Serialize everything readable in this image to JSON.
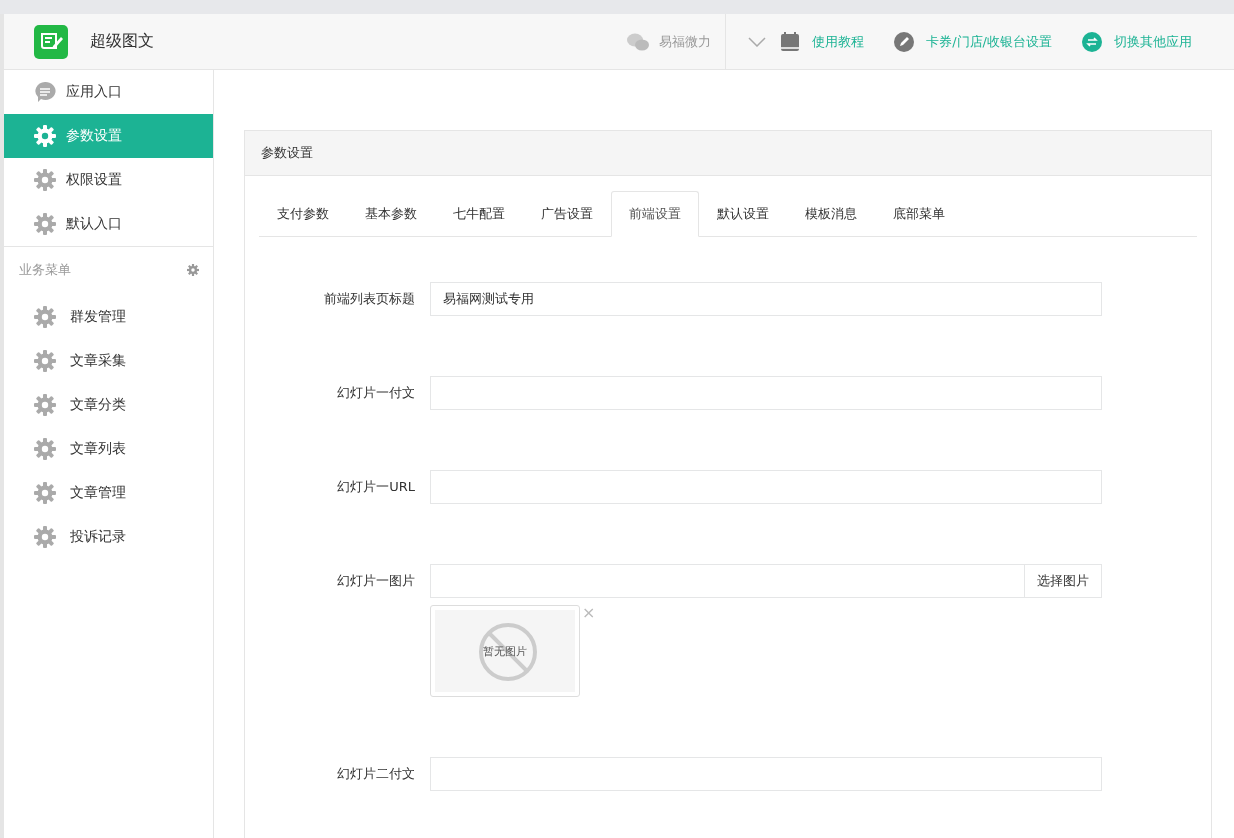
{
  "header": {
    "title": "超级图文",
    "account": "易福微力",
    "links": [
      {
        "label": "使用教程"
      },
      {
        "label": "卡券/门店/收银台设置"
      },
      {
        "label": "切换其他应用"
      }
    ]
  },
  "sidebar": {
    "items": [
      {
        "label": "应用入口",
        "selected": false
      },
      {
        "label": "参数设置",
        "selected": true
      },
      {
        "label": "权限设置",
        "selected": false
      },
      {
        "label": "默认入口",
        "selected": false
      }
    ],
    "section": {
      "title": "业务菜单",
      "items": [
        {
          "label": "群发管理",
          "selected": false
        },
        {
          "label": "文章采集",
          "selected": false
        },
        {
          "label": "文章分类",
          "selected": false
        },
        {
          "label": "文章列表",
          "selected": false
        },
        {
          "label": "文章管理",
          "selected": false
        },
        {
          "label": "投诉记录",
          "selected": false
        }
      ]
    }
  },
  "panel": {
    "title": "参数设置",
    "tabs": [
      {
        "label": "支付参数",
        "selected": false
      },
      {
        "label": "基本参数",
        "selected": false
      },
      {
        "label": "七牛配置",
        "selected": false
      },
      {
        "label": "广告设置",
        "selected": false
      },
      {
        "label": "前端设置",
        "selected": true
      },
      {
        "label": "默认设置",
        "selected": false
      },
      {
        "label": "模板消息",
        "selected": false
      },
      {
        "label": "底部菜单",
        "selected": false
      }
    ],
    "fields": [
      {
        "label": "前端列表页标题",
        "kind": "text",
        "value": "易福网测试专用"
      },
      {
        "label": "幻灯片一付文",
        "kind": "text"
      },
      {
        "label": "幻灯片一URL",
        "kind": "text"
      },
      {
        "label": "幻灯片一图片",
        "kind": "image",
        "button": "选择图片",
        "preview_text": "暂无图片",
        "remove": "×"
      },
      {
        "label": "幻灯片二付文",
        "kind": "text"
      }
    ]
  }
}
